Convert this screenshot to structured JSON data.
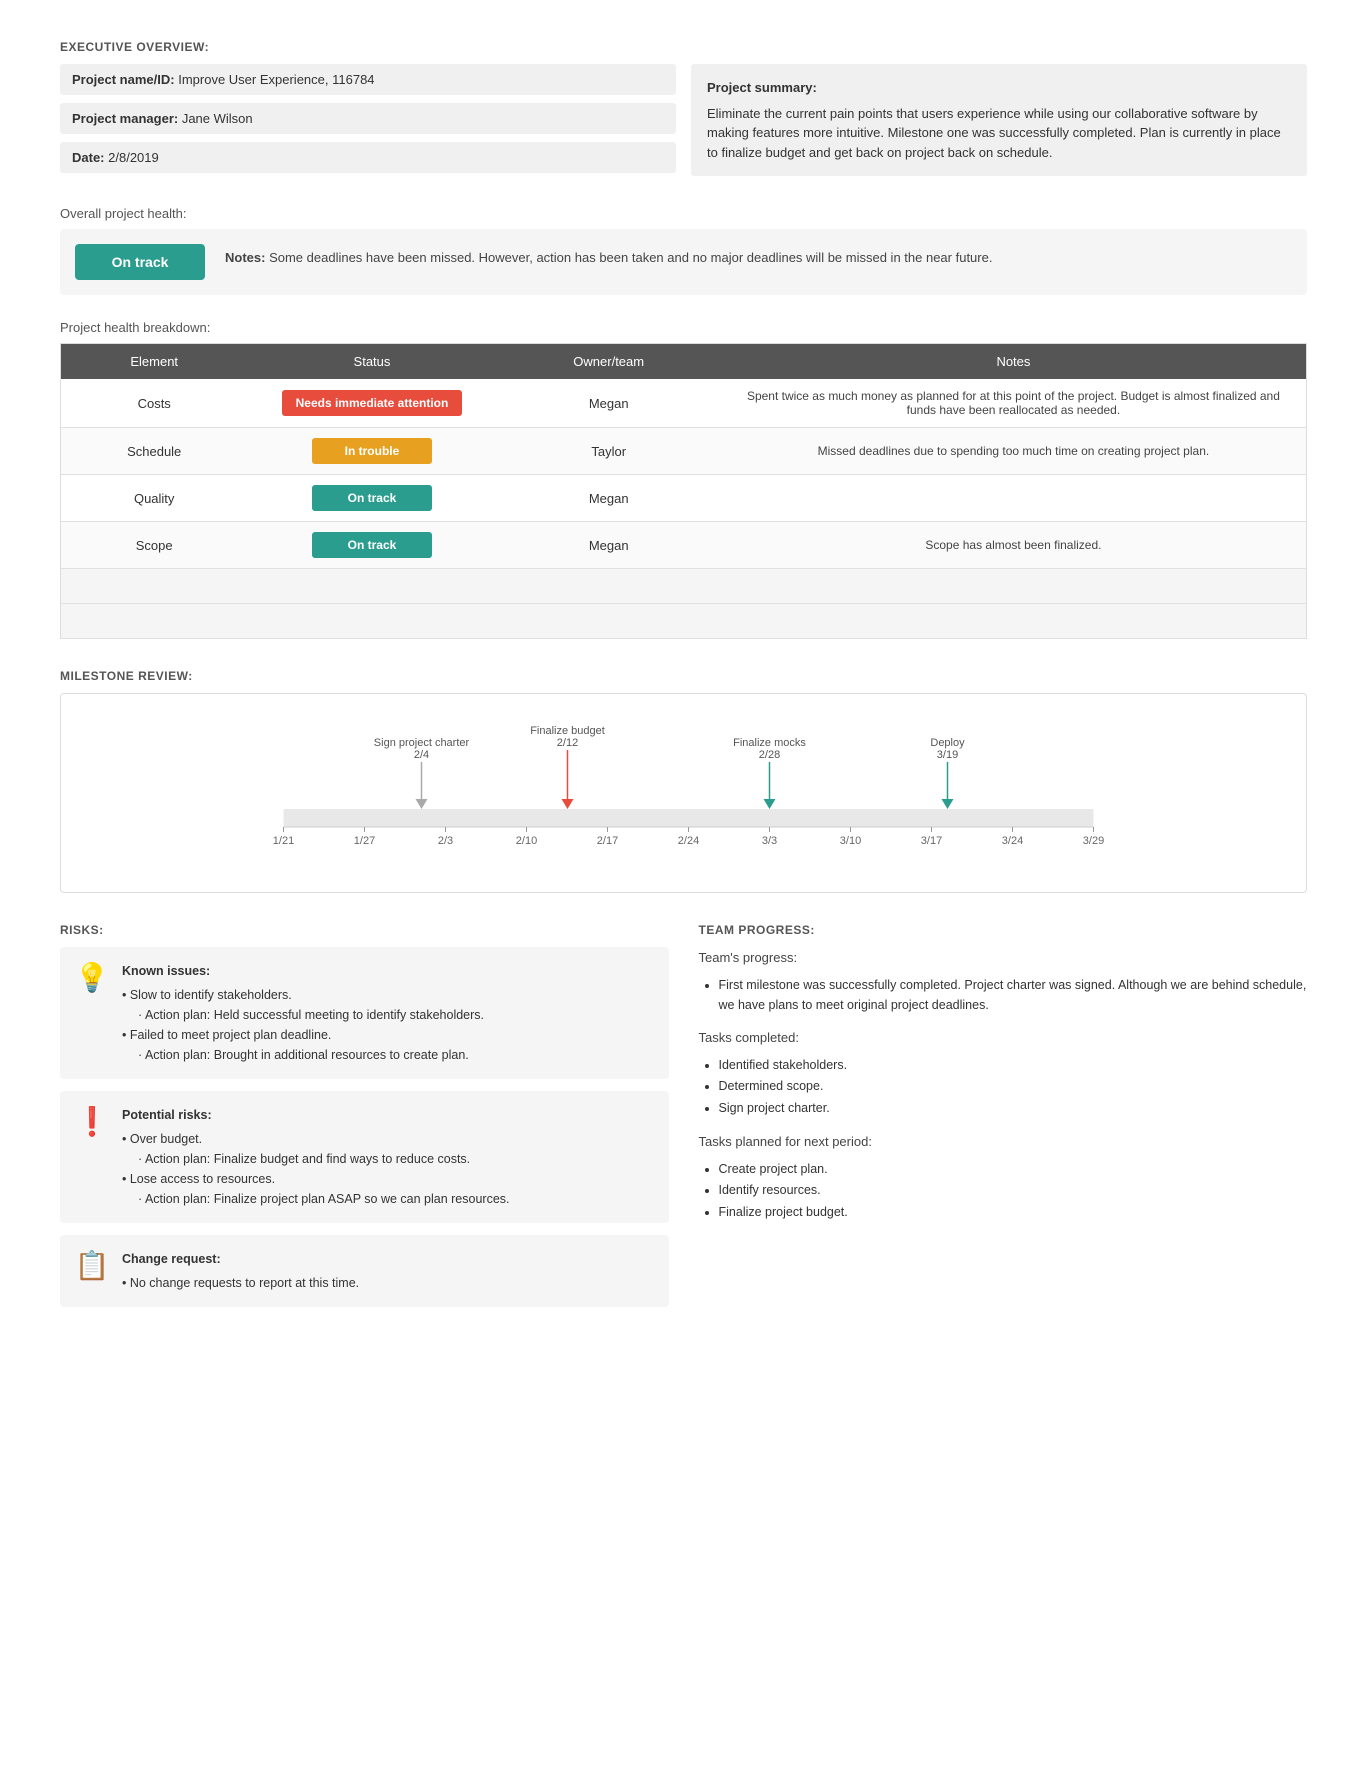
{
  "exec_overview": {
    "title": "EXECUTIVE OVERVIEW:",
    "project_name_label": "Project name/ID:",
    "project_name_value": "Improve User Experience, 116784",
    "manager_label": "Project manager:",
    "manager_value": "Jane Wilson",
    "date_label": "Date:",
    "date_value": "2/8/2019",
    "summary_label": "Project summary:",
    "summary_text": "Eliminate the current pain points that users experience while using our collaborative software by making features more intuitive. Milestone one was successfully completed. Plan is currently in place to finalize budget and get back on project back on schedule."
  },
  "overall_health": {
    "label": "Overall project health:",
    "status": "On track",
    "notes_label": "Notes:",
    "notes_text": "Some deadlines have been missed. However, action has been taken and no major deadlines will be missed in the near future."
  },
  "breakdown": {
    "label": "Project health breakdown:",
    "headers": [
      "Element",
      "Status",
      "Owner/team",
      "Notes"
    ],
    "rows": [
      {
        "element": "Costs",
        "status": "Needs immediate attention",
        "status_type": "red",
        "owner": "Megan",
        "notes": "Spent twice as much money as planned for at this point of the project. Budget is almost finalized and funds have been reallocated as needed."
      },
      {
        "element": "Schedule",
        "status": "In trouble",
        "status_type": "orange",
        "owner": "Taylor",
        "notes": "Missed deadlines due to spending too much time on creating project plan."
      },
      {
        "element": "Quality",
        "status": "On track",
        "status_type": "teal",
        "owner": "Megan",
        "notes": ""
      },
      {
        "element": "Scope",
        "status": "On track",
        "status_type": "teal",
        "owner": "Megan",
        "notes": "Scope has almost been finalized."
      }
    ]
  },
  "milestone": {
    "title": "MILESTONE REVIEW:",
    "markers": [
      {
        "label": "Sign project charter",
        "date": "2/4",
        "x_pct": 17,
        "color": "#aaa",
        "arrow_color": "#aaa"
      },
      {
        "label": "Finalize budget",
        "date": "2/12",
        "x_pct": 35,
        "color": "#e74c3c",
        "arrow_color": "#e74c3c"
      },
      {
        "label": "Finalize mocks",
        "date": "2/28",
        "x_pct": 60,
        "color": "#2a9d8f",
        "arrow_color": "#2a9d8f"
      },
      {
        "label": "Deploy",
        "date": "3/19",
        "x_pct": 82,
        "color": "#2a9d8f",
        "arrow_color": "#2a9d8f"
      }
    ],
    "x_labels": [
      "1/21",
      "1/27",
      "2/3",
      "2/10",
      "2/17",
      "2/24",
      "3/3",
      "3/10",
      "3/17",
      "3/24",
      "3/29"
    ]
  },
  "risks": {
    "title": "RISKS:",
    "items": [
      {
        "icon": "💡",
        "heading": "Known issues:",
        "content": "• Slow to identify stakeholders.\n  · Action plan: Held successful meeting to identify stakeholders.\n• Failed to meet project plan deadline.\n  · Action plan: Brought in additional resources to create plan."
      },
      {
        "icon": "❗",
        "heading": "Potential risks:",
        "content": "• Over budget.\n  · Action plan: Finalize budget and find ways to reduce costs.\n• Lose access to resources.\n  · Action plan: Finalize project plan ASAP so we can plan resources."
      },
      {
        "icon": "📋",
        "heading": "Change request:",
        "content": "• No change requests to report at this time."
      }
    ]
  },
  "team_progress": {
    "title": "TEAM PROGRESS:",
    "progress_label": "Team's progress:",
    "progress_text": "First milestone was successfully completed. Project charter was signed. Although we are behind schedule, we have plans to meet original project deadlines.",
    "completed_label": "Tasks completed:",
    "completed_items": [
      "Identified stakeholders.",
      "Determined scope.",
      "Sign project charter."
    ],
    "planned_label": "Tasks planned for next period:",
    "planned_items": [
      "Create project plan.",
      "Identify resources.",
      "Finalize project budget."
    ]
  }
}
